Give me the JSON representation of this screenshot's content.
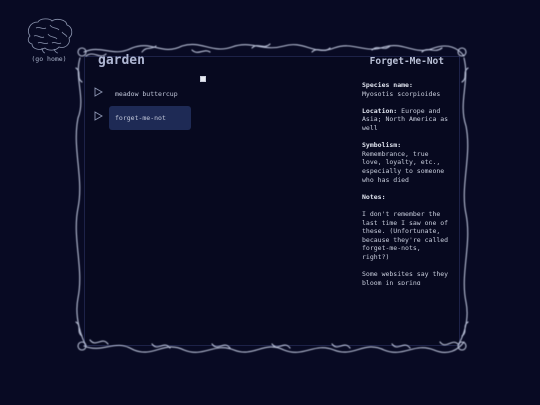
{
  "nav": {
    "home_label": "(go home)"
  },
  "page": {
    "title": "garden"
  },
  "plants": [
    {
      "label": "meadow buttercup",
      "active": false
    },
    {
      "label": "forget-me-not",
      "active": true
    }
  ],
  "detail": {
    "heading": "Forget-Me-Not",
    "species_key": "Species name:",
    "species_value": "Myosotis scorpioides",
    "location_key": "Location:",
    "location_value": "Europe and Asia; North America as well",
    "symbolism_key": "Symbolism:",
    "symbolism_value": "Remembrance, true love, loyalty, etc., especially to someone who has died",
    "notes_key": "Notes:",
    "notes_paragraph_1": "I don't remember the last time I saw one of these. (Unfortunate, because they're called forget-me-nots, right?)",
    "notes_paragraph_2": "Some websites say they bloom in spring"
  },
  "colors": {
    "background": "#080a23",
    "accent": "#1e2a55",
    "text": "#c9cedd"
  }
}
